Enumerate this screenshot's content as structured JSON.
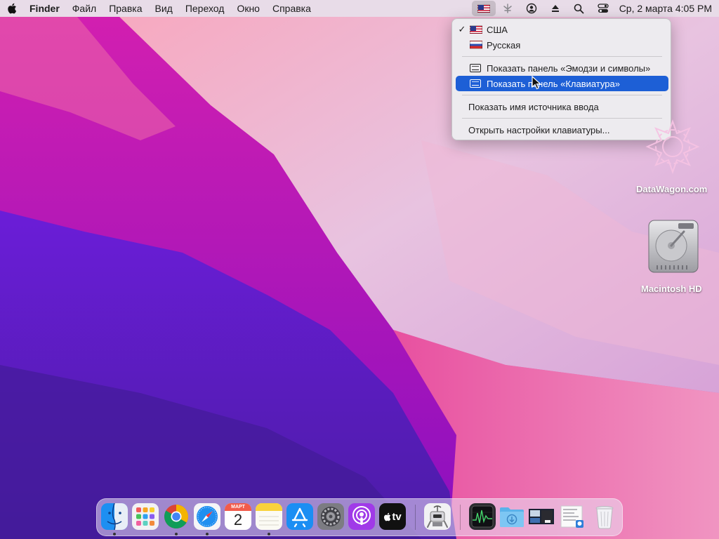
{
  "menubar": {
    "app_name": "Finder",
    "menus": [
      "Файл",
      "Правка",
      "Вид",
      "Переход",
      "Окно",
      "Справка"
    ],
    "clock": "Ср, 2 марта  4:05 PM",
    "status_icons": [
      "us-flag-input-icon",
      "network-icon",
      "user-icon",
      "eject-icon",
      "search-icon",
      "control-center-icon"
    ]
  },
  "input_menu": {
    "items": [
      {
        "label": "США",
        "checked": true,
        "icon": "us-flag-icon"
      },
      {
        "label": "Русская",
        "checked": false,
        "icon": "ru-flag-icon"
      },
      {
        "label": "Показать панель «Эмодзи и символы»",
        "icon": "emoji-panel-icon"
      },
      {
        "label": "Показать панель «Клавиатура»",
        "icon": "keyboard-viewer-icon",
        "highlighted": true
      },
      {
        "label": "Показать имя источника ввода"
      },
      {
        "label": "Открыть настройки клавиатуры..."
      }
    ],
    "checkmark": "✓",
    "highlight_color": "#1d5fd6"
  },
  "desktop": {
    "icons": [
      {
        "label": "DataWagon.com"
      },
      {
        "label": "Macintosh HD"
      }
    ]
  },
  "dock": {
    "calendar_month": "МАРТ",
    "calendar_day": "2",
    "tv_label": "tv",
    "apps": [
      "finder",
      "launchpad",
      "chrome",
      "safari",
      "calendar",
      "notes",
      "app-store",
      "system-preferences",
      "podcasts",
      "apple-tv",
      "automator",
      "activity-monitor",
      "downloads",
      "screenshot",
      "preview",
      "trash"
    ]
  }
}
